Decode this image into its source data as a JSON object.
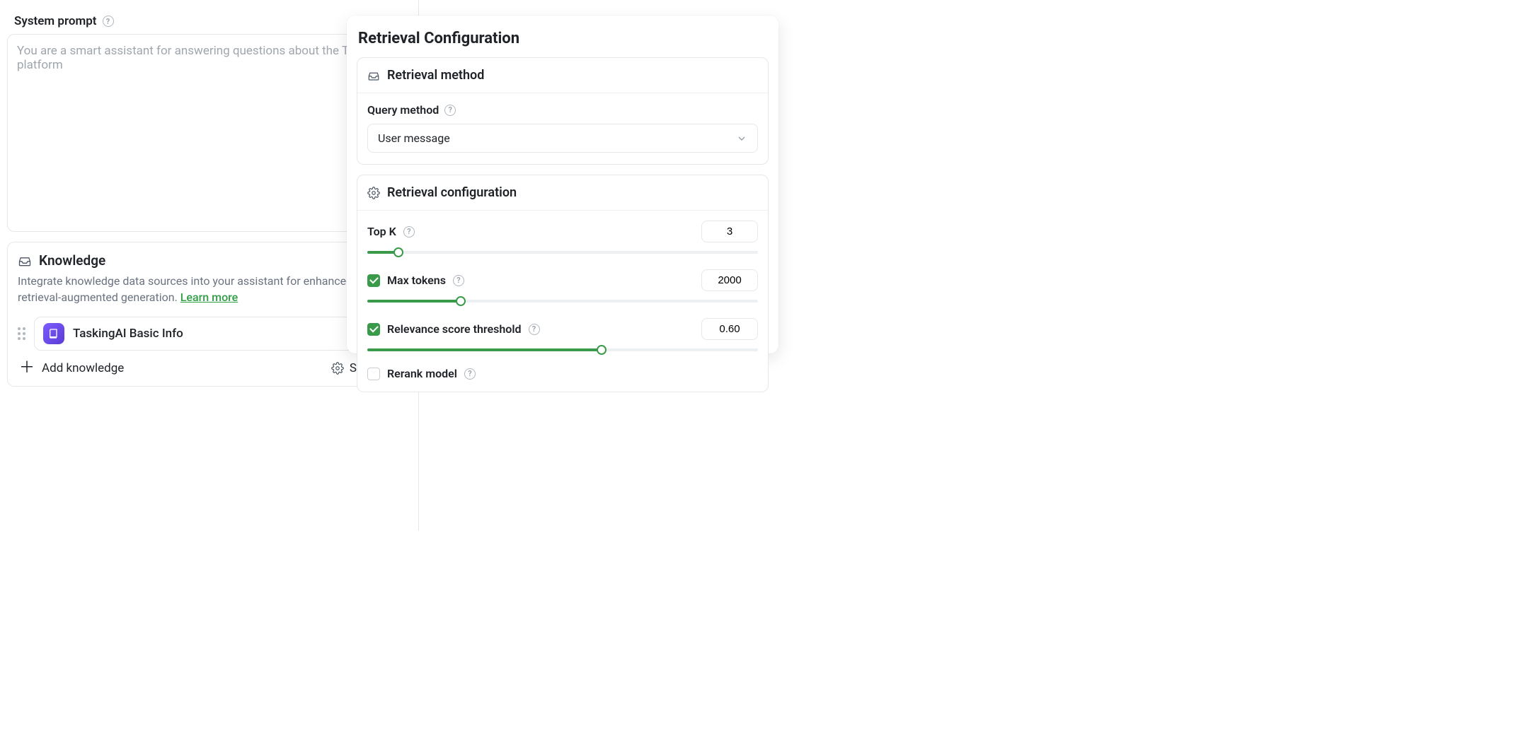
{
  "system_prompt": {
    "label": "System prompt",
    "placeholder": "You are a smart assistant for answering questions about the TaskingAI platform",
    "value": ""
  },
  "knowledge": {
    "title": "Knowledge",
    "description": "Integrate knowledge data sources into your assistant for enhanced retrieval-augmented generation. ",
    "learn_more": "Learn more",
    "items": [
      {
        "label": "TaskingAI Basic Info"
      }
    ],
    "add_label": "Add knowledge",
    "settings_label": "Settings"
  },
  "retrieval": {
    "panel_title": "Retrieval Configuration",
    "method_card_title": "Retrieval method",
    "query_method_label": "Query method",
    "query_method_value": "User message",
    "config_card_title": "Retrieval configuration",
    "top_k": {
      "label": "Top K",
      "value": "3",
      "fill_pct": 8
    },
    "max_tokens": {
      "label": "Max tokens",
      "checked": true,
      "value": "2000",
      "fill_pct": 24
    },
    "relevance": {
      "label": "Relevance score threshold",
      "checked": true,
      "value": "0.60",
      "fill_pct": 60
    },
    "rerank": {
      "label": "Rerank model",
      "checked": false
    }
  }
}
